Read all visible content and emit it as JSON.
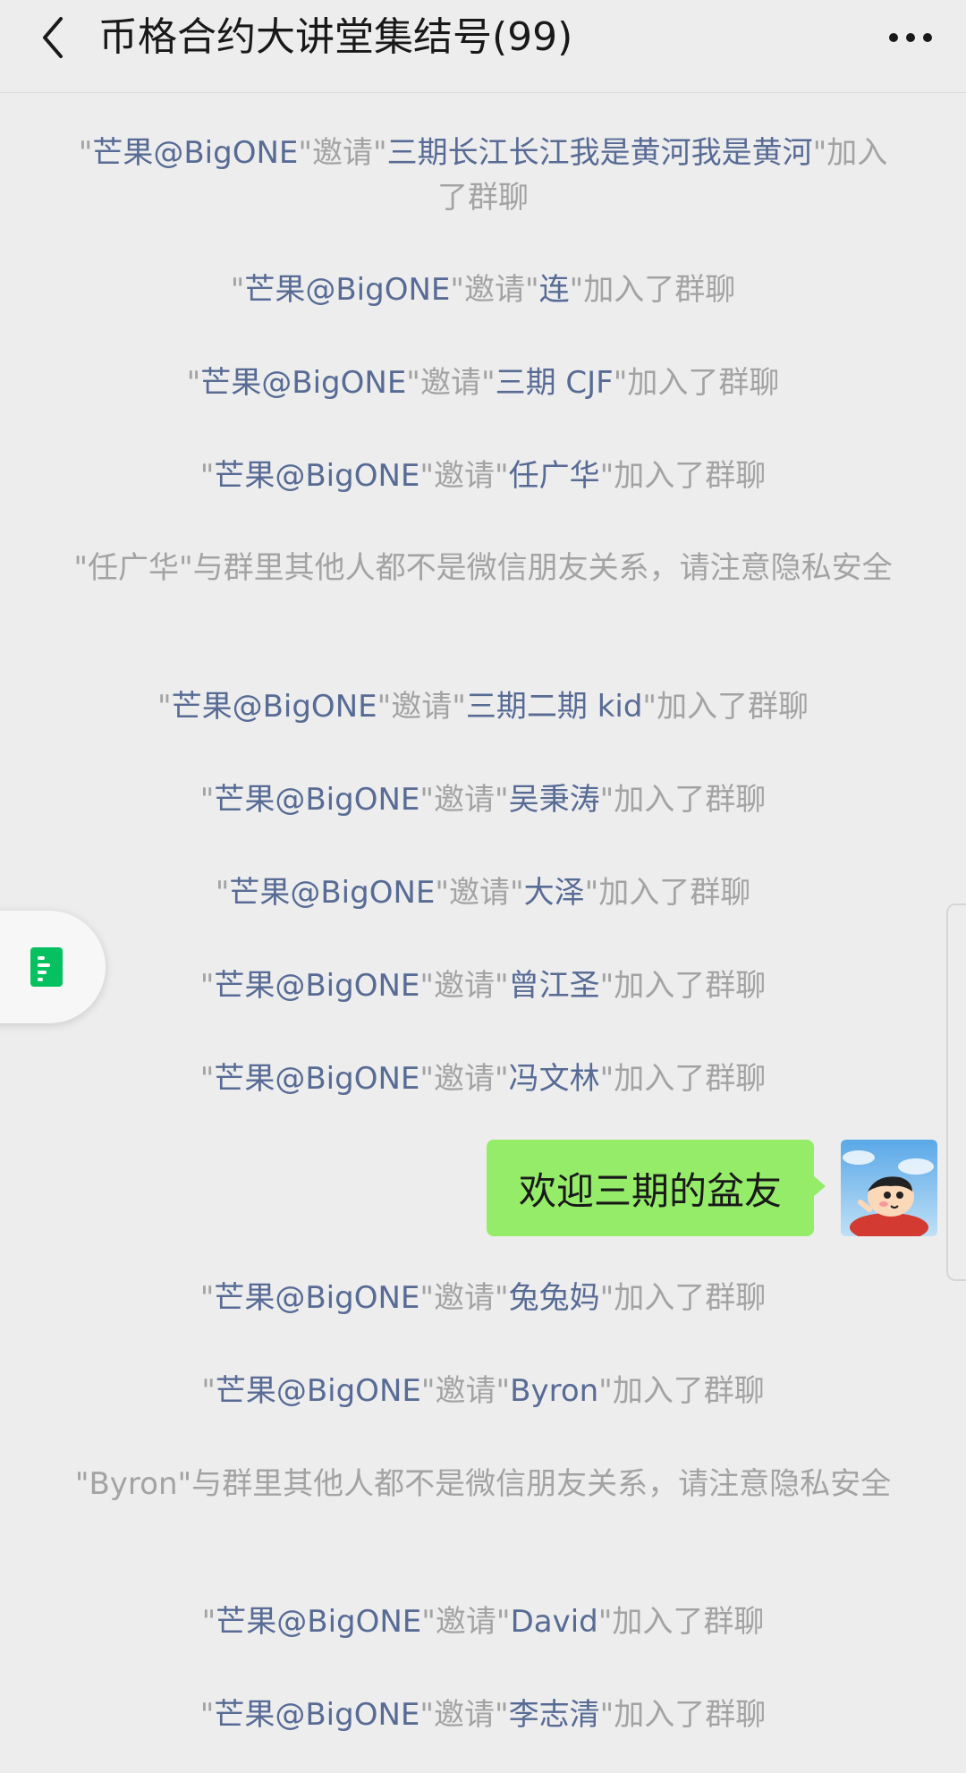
{
  "header": {
    "title": "币格合约大讲堂集结号(99)",
    "back_icon": "chevron-left-icon",
    "more_icon": "more-dots-icon"
  },
  "messages": [
    {
      "type": "system",
      "inviter": "芒果@BigONE",
      "verb": "邀请",
      "invitee": "三期长江长江我是黄河我是黄河",
      "suffix": "加入了群聊"
    },
    {
      "type": "system",
      "inviter": "芒果@BigONE",
      "verb": "邀请",
      "invitee": "连",
      "suffix": "加入了群聊"
    },
    {
      "type": "system",
      "inviter": "芒果@BigONE",
      "verb": "邀请",
      "invitee": "三期 CJF",
      "suffix": "加入了群聊"
    },
    {
      "type": "system",
      "inviter": "芒果@BigONE",
      "verb": "邀请",
      "invitee": "任广华",
      "suffix": "加入了群聊"
    },
    {
      "type": "notice",
      "text": "\"任广华\"与群里其他人都不是微信朋友关系，请注意隐私安全"
    },
    {
      "type": "system",
      "inviter": "芒果@BigONE",
      "verb": "邀请",
      "invitee": "三期二期 kid",
      "suffix": "加入了群聊"
    },
    {
      "type": "system",
      "inviter": "芒果@BigONE",
      "verb": "邀请",
      "invitee": "吴秉涛",
      "suffix": "加入了群聊"
    },
    {
      "type": "system",
      "inviter": "芒果@BigONE",
      "verb": "邀请",
      "invitee": "大泽",
      "suffix": "加入了群聊"
    },
    {
      "type": "system",
      "inviter": "芒果@BigONE",
      "verb": "邀请",
      "invitee": "曾江圣",
      "suffix": "加入了群聊"
    },
    {
      "type": "system",
      "inviter": "芒果@BigONE",
      "verb": "邀请",
      "invitee": "冯文林",
      "suffix": "加入了群聊"
    },
    {
      "type": "sent",
      "text": "欢迎三期的盆友"
    },
    {
      "type": "system",
      "inviter": "芒果@BigONE",
      "verb": "邀请",
      "invitee": "兔兔妈",
      "suffix": "加入了群聊"
    },
    {
      "type": "system",
      "inviter": "芒果@BigONE",
      "verb": "邀请",
      "invitee": "Byron",
      "suffix": "加入了群聊"
    },
    {
      "type": "notice",
      "text": "\"Byron\"与群里其他人都不是微信朋友关系，请注意隐私安全"
    },
    {
      "type": "system",
      "inviter": "芒果@BigONE",
      "verb": "邀请",
      "invitee": "David",
      "suffix": "加入了群聊"
    },
    {
      "type": "system",
      "inviter": "芒果@BigONE",
      "verb": "邀请",
      "invitee": "李志清",
      "suffix": "加入了群聊"
    }
  ],
  "colors": {
    "background": "#ededed",
    "name_link": "#576b95",
    "system_text": "#a3a3a3",
    "bubble_green": "#95ec69"
  }
}
